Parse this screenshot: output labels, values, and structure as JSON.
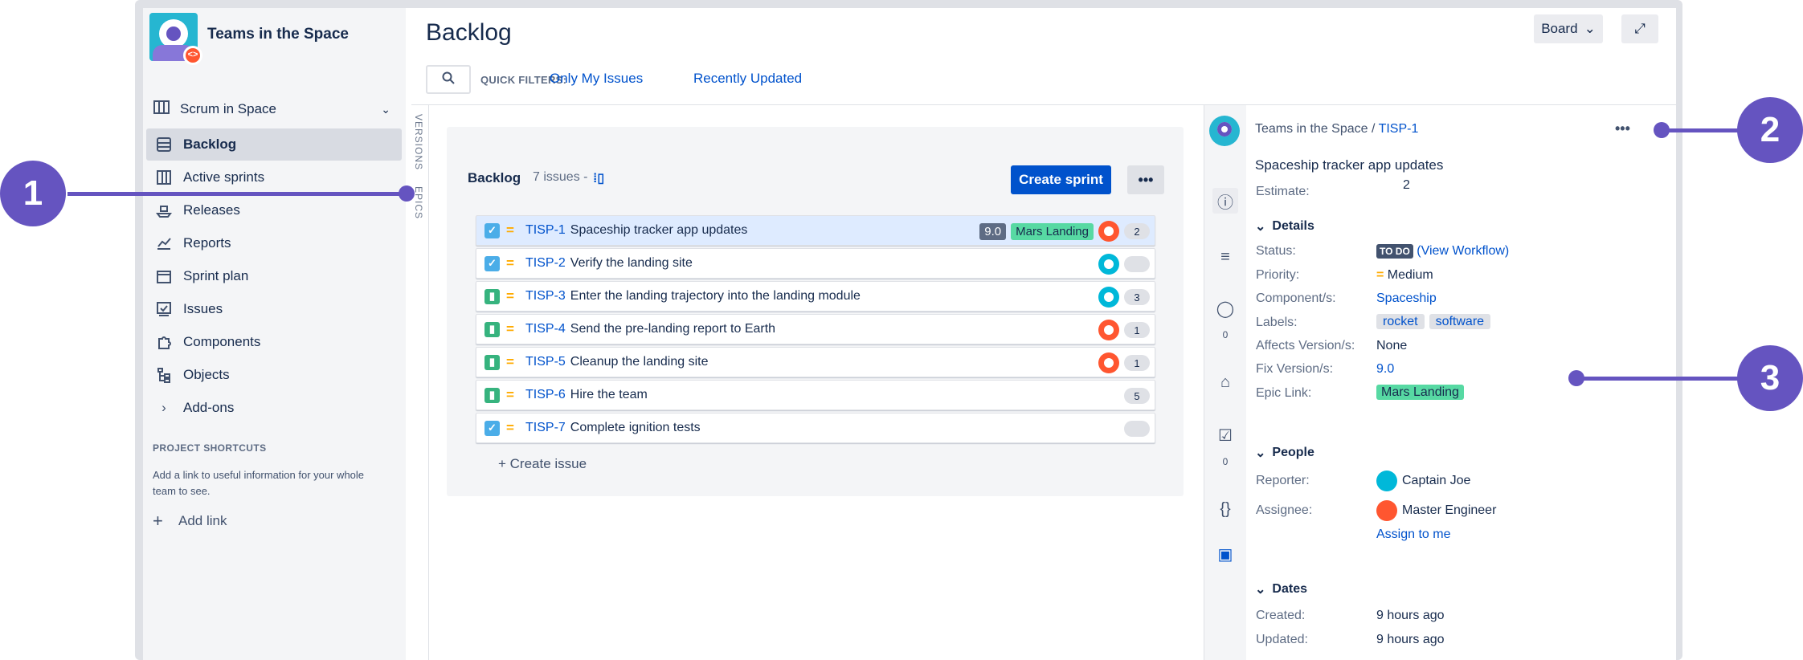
{
  "project": {
    "name": "Teams in the Space",
    "badge_icon": "code-icon"
  },
  "sidebar": {
    "board_selector": "Scrum in Space",
    "items": [
      {
        "label": "Backlog",
        "icon": "backlog-icon",
        "active": true
      },
      {
        "label": "Active sprints",
        "icon": "board-icon"
      },
      {
        "label": "Releases",
        "icon": "ship-icon"
      },
      {
        "label": "Reports",
        "icon": "chart-icon"
      },
      {
        "label": "Sprint plan",
        "icon": "calendar-icon"
      },
      {
        "label": "Issues",
        "icon": "issues-icon"
      },
      {
        "label": "Components",
        "icon": "puzzle-icon"
      },
      {
        "label": "Objects",
        "icon": "tree-icon"
      },
      {
        "label": "Add-ons",
        "icon": "chevron-right-icon"
      }
    ],
    "shortcuts_heading": "PROJECT SHORTCUTS",
    "shortcuts_desc": "Add a link to useful information for your whole team to see.",
    "add_link": "Add link"
  },
  "header": {
    "title": "Backlog",
    "board_button": "Board",
    "quick_filters_label": "QUICK FILTERS:",
    "filters": [
      "Only My Issues",
      "Recently Updated"
    ]
  },
  "side_labels": {
    "versions": "VERSIONS",
    "epics": "EPICS"
  },
  "backlog": {
    "title": "Backlog",
    "count": "7 issues",
    "separator": "-",
    "create_sprint": "Create sprint",
    "issues": [
      {
        "key": "TISP-1",
        "summary": "Spaceship tracker app updates",
        "type": "task",
        "fix": "9.0",
        "epic": "Mars Landing",
        "assignee": "red",
        "points": "2",
        "selected": true
      },
      {
        "key": "TISP-2",
        "summary": "Verify the landing site",
        "type": "task",
        "assignee": "teal",
        "points": ""
      },
      {
        "key": "TISP-3",
        "summary": "Enter the landing trajectory into the landing module",
        "type": "story",
        "assignee": "teal",
        "points": "3"
      },
      {
        "key": "TISP-4",
        "summary": "Send the pre-landing report to Earth",
        "type": "story",
        "assignee": "red",
        "points": "1"
      },
      {
        "key": "TISP-5",
        "summary": "Cleanup the landing site",
        "type": "story",
        "assignee": "red",
        "points": "1"
      },
      {
        "key": "TISP-6",
        "summary": "Hire the team",
        "type": "story",
        "points": "5"
      },
      {
        "key": "TISP-7",
        "summary": "Complete ignition tests",
        "type": "task",
        "points": ""
      }
    ],
    "create_issue": "Create issue"
  },
  "detail": {
    "project": "Teams in the Space",
    "key": "TISP-1",
    "summary": "Spaceship tracker app updates",
    "estimate_label": "Estimate:",
    "estimate": "2",
    "details_heading": "Details",
    "status_label": "Status:",
    "status": "TO DO",
    "view_workflow": "(View Workflow)",
    "priority_label": "Priority:",
    "priority": "Medium",
    "component_label": "Component/s:",
    "component": "Spaceship",
    "labels_label": "Labels:",
    "labels": [
      "rocket",
      "software"
    ],
    "affects_label": "Affects Version/s:",
    "affects": "None",
    "fix_label": "Fix Version/s:",
    "fix": "9.0",
    "epic_label": "Epic Link:",
    "epic": "Mars Landing",
    "people_heading": "People",
    "reporter_label": "Reporter:",
    "reporter": "Captain Joe",
    "assignee_label": "Assignee:",
    "assignee": "Master Engineer",
    "assign_to_me": "Assign to me",
    "dates_heading": "Dates",
    "created_label": "Created:",
    "created": "9 hours ago",
    "updated_label": "Updated:",
    "updated": "9 hours ago",
    "tab_counts": [
      "0",
      "0"
    ]
  },
  "callouts": [
    "1",
    "2",
    "3"
  ],
  "colors": {
    "accent": "#0052cc",
    "callout": "#6554c0",
    "epic": "#57d9a3"
  }
}
